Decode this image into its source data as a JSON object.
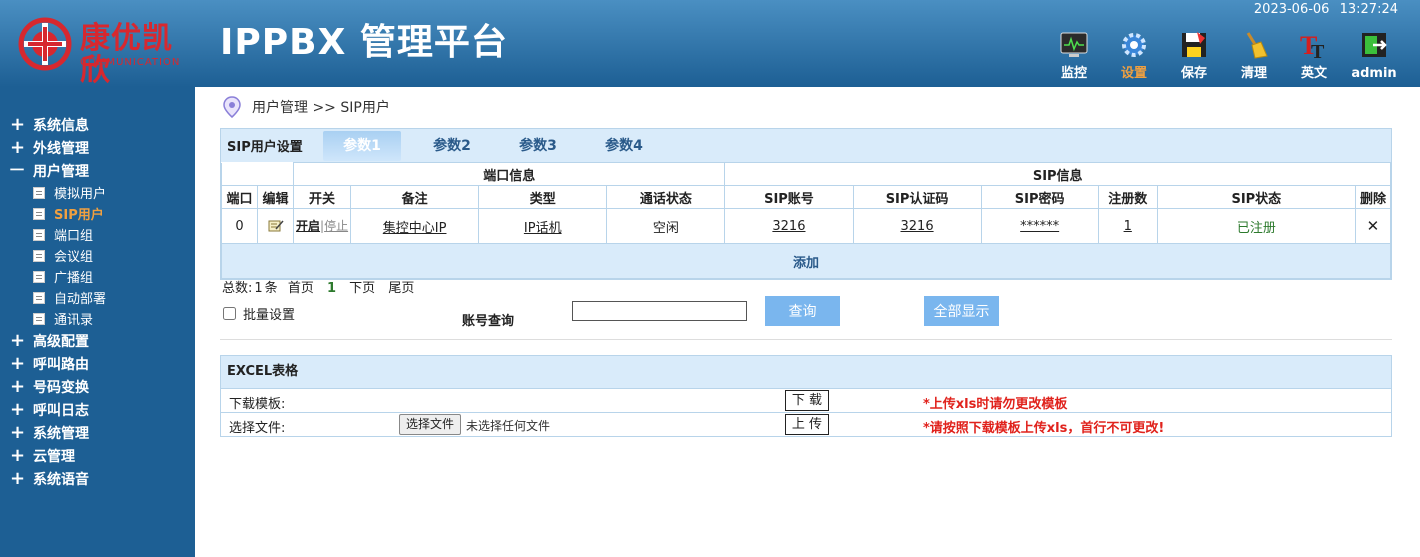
{
  "header": {
    "logo_cn": "康优凯欣",
    "logo_en": "COMMUNICATION",
    "title": "IPPBX 管理平台",
    "date": "2023-06-06",
    "time": "13:27:24",
    "toolbar": [
      {
        "label": "监控",
        "icon": "monitor-icon"
      },
      {
        "label": "设置",
        "icon": "gear-icon",
        "active": true
      },
      {
        "label": "保存",
        "icon": "save-icon"
      },
      {
        "label": "清理",
        "icon": "broom-icon"
      },
      {
        "label": "英文",
        "icon": "language-icon"
      },
      {
        "label": "admin",
        "icon": "logout-icon"
      }
    ]
  },
  "sidebar": {
    "menus": [
      "系统信息",
      "外线管理",
      "用户管理",
      "高级配置",
      "呼叫路由",
      "号码变换",
      "呼叫日志",
      "系统管理",
      "云管理",
      "系统语音"
    ],
    "expanded_sign": "一",
    "collapsed_sign": "+",
    "submenus": [
      "模拟用户",
      "SIP用户",
      "端口组",
      "会议组",
      "广播组",
      "自动部署",
      "通讯录"
    ],
    "active_sub": "SIP用户"
  },
  "breadcrumb": "用户管理 >> SIP用户",
  "settings": {
    "title": "SIP用户设置",
    "tabs": [
      "参数1",
      "参数2",
      "参数3",
      "参数4"
    ],
    "active_tab": "参数1",
    "group_headers": [
      "端口信息",
      "SIP信息"
    ],
    "columns": [
      "端口",
      "编辑",
      "开关",
      "备注",
      "类型",
      "通话状态",
      "SIP账号",
      "SIP认证码",
      "SIP密码",
      "注册数",
      "SIP状态",
      "删除"
    ],
    "rows": [
      {
        "port": "0",
        "switch_on": "开启",
        "switch_sep": "|",
        "switch_off": "停止",
        "note": "集控中心IP",
        "type": "IP话机",
        "call_status": "空闲",
        "account": "3216",
        "auth": "3216",
        "password": "******",
        "reg_count": "1",
        "sip_status": "已注册",
        "delete": "✕"
      }
    ],
    "add_label": "添加"
  },
  "pager": {
    "total_label": "总数:",
    "total": "1",
    "unit": "条",
    "first": "首页",
    "current": "1",
    "next": "下页",
    "last": "尾页"
  },
  "batch_label": "批量设置",
  "query": {
    "label": "账号查询",
    "value": "",
    "search_btn": "查询",
    "show_all_btn": "全部显示"
  },
  "excel": {
    "title": "EXCEL表格",
    "download_label": "下载模板:",
    "download_btn": "下 载",
    "download_warn": "*上传xls时请勿更改模板",
    "upload_label": "选择文件:",
    "file_btn": "选择文件",
    "file_info": "未选择任何文件",
    "upload_btn": "上 传",
    "upload_warn": "*请按照下载模板上传xls，首行不可更改!"
  },
  "colors": {
    "header_top": "#4a8fc2",
    "sidebar": "#1d5f94",
    "accent": "#f0a040",
    "table_head": "#d9ebfa",
    "button": "#7ab6ee",
    "warn": "#e0221c",
    "logo": "#d7282f"
  }
}
